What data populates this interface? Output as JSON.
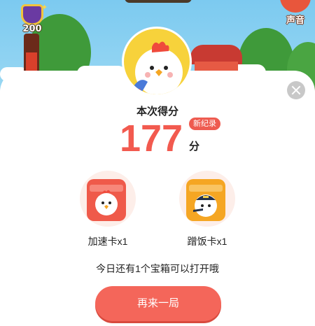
{
  "hud": {
    "level": "200",
    "progress": 0.55,
    "sound_label": "声音"
  },
  "result": {
    "title": "本次得分",
    "score": "177",
    "unit": "分",
    "record_badge": "新纪录"
  },
  "rewards": [
    {
      "label": "加速卡x1",
      "icon": "chick-card-icon",
      "color": "#ef5a4a"
    },
    {
      "label": "蹭饭卡x1",
      "icon": "chick-captain-card-icon",
      "color": "#f5a623"
    }
  ],
  "chest_note": "今日还有1个宝箱可以打开哦",
  "replay_label": "再来一局",
  "colors": {
    "accent": "#f25a4f",
    "sheet_bg": "#ffffff",
    "sky": "#7ec8ee"
  }
}
